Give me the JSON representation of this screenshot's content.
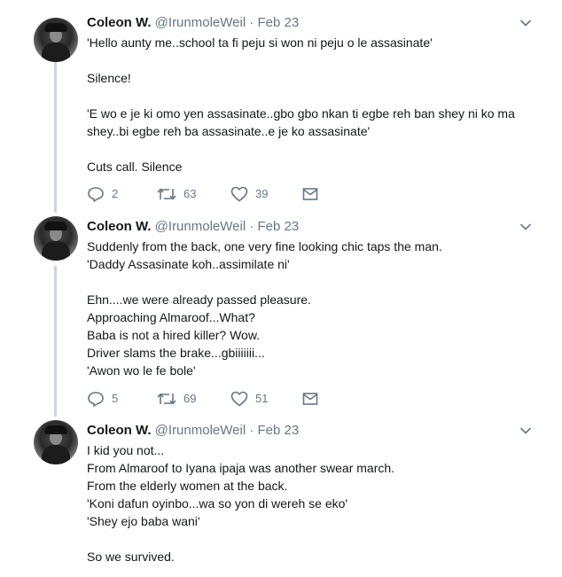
{
  "tweets": [
    {
      "name": "Coleon W.",
      "handle": "@IrunmoleWeil",
      "separator": "·",
      "date": "Feb 23",
      "lines": [
        "'Hello aunty me..school ta fi peju si won ni peju o le assasinate'",
        "",
        "Silence!",
        "",
        "'E wo e je ki omo yen assasinate..gbo gbo nkan ti egbe reh ban shey ni ko ma",
        "shey..bi egbe reh ba assasinate..e je ko assasinate'",
        "",
        "Cuts call. Silence"
      ],
      "replies": "2",
      "retweets": "63",
      "likes": "39"
    },
    {
      "name": "Coleon W.",
      "handle": "@IrunmoleWeil",
      "separator": "·",
      "date": "Feb 23",
      "lines": [
        "Suddenly from the back, one very fine looking chic taps the man.",
        "'Daddy Assasinate koh..assimilate ni'",
        "",
        "Ehn....we were already passed pleasure.",
        "Approaching Almaroof...What?",
        "Baba is not a hired killer? Wow.",
        "Driver slams the brake...gbiiiiiii...",
        "'Awon wo le fe bole'"
      ],
      "replies": "5",
      "retweets": "69",
      "likes": "51"
    },
    {
      "name": "Coleon W.",
      "handle": "@IrunmoleWeil",
      "separator": "·",
      "date": "Feb 23",
      "lines": [
        "I kid you not...",
        "From Almaroof to Iyana ipaja was another swear march.",
        "From the elderly women at the back.",
        "'Koni dafun oyinbo...wa so yon di wereh se eko'",
        "'Shey ejo baba wani'",
        "",
        "So we survived."
      ]
    }
  ],
  "icons": {
    "caret": "chevron-down-icon",
    "reply": "reply-icon",
    "retweet": "retweet-icon",
    "like": "heart-icon",
    "message": "envelope-icon"
  },
  "colors": {
    "text": "#14171a",
    "secondary": "#657786",
    "thread_line": "#ccd6dd",
    "icon": "#657786"
  }
}
